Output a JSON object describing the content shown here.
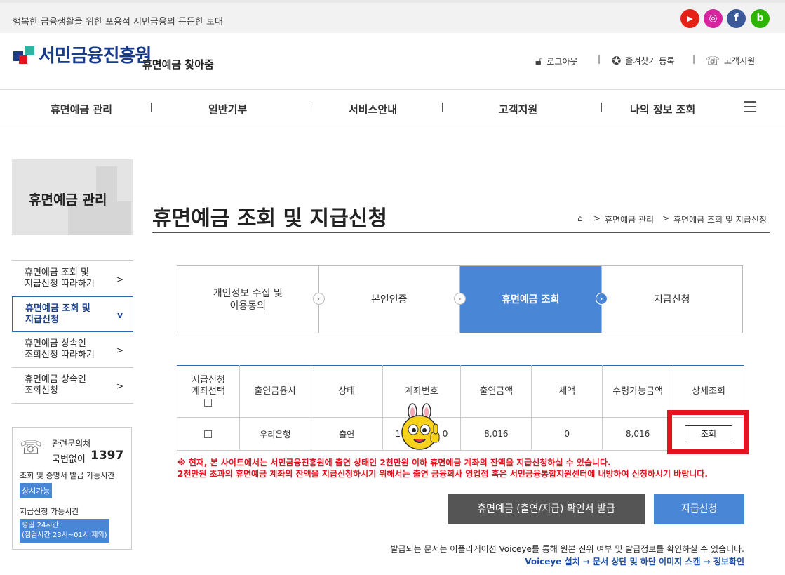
{
  "topbar": {
    "tagline": "행복한 금융생활을 위한 포용적 서민금융의 든든한 토대",
    "social": [
      {
        "name": "youtube-icon",
        "glyph": "▶",
        "color": "#e62117"
      },
      {
        "name": "instagram-icon",
        "glyph": "◎",
        "color": "#d6249f"
      },
      {
        "name": "facebook-icon",
        "glyph": "f",
        "color": "#3b5998"
      },
      {
        "name": "blog-icon",
        "glyph": "b",
        "color": "#2db400"
      }
    ]
  },
  "header": {
    "logo": "서민금융진흥원",
    "subtitle": "휴면예금 찾아줌",
    "logout": "로그아웃",
    "bookmark": "즐겨찾기 등록",
    "support": "고객지원"
  },
  "gnb": [
    "휴면예금 관리",
    "일반기부",
    "서비스안내",
    "고객지원",
    "나의 정보 조회"
  ],
  "sidebar": {
    "title": "휴면예금 관리",
    "items": [
      {
        "label": [
          "휴면예금 조회 및",
          "지급신청 따라하기"
        ],
        "arrow": ">"
      },
      {
        "label": [
          "휴면예금 조회 및",
          "지급신청"
        ],
        "arrow": "v"
      },
      {
        "label": [
          "휴면예금 상속인",
          "조회신청 따라하기"
        ],
        "arrow": ">"
      },
      {
        "label": [
          "휴면예금 상속인",
          "조회신청"
        ],
        "arrow": ">"
      }
    ],
    "cs": {
      "title": "관련문의처",
      "tollfree": "국번없이",
      "phone": "1397",
      "hours_label": "조회 및 증명서 발급 가능시간",
      "hours_value": "상시가능",
      "pay_label": "지급신청 가능시간",
      "pay_value1": "평일 24시간",
      "pay_value2": "(점검시간 23시~01시 제외)"
    }
  },
  "page": {
    "title": "휴면예금 조회 및 지급신청",
    "crumb1": "휴면예금 관리",
    "crumb2": "휴면예금 조회 및 지급신청"
  },
  "steps": [
    {
      "label": [
        "개인정보 수집 및",
        "이용동의"
      ],
      "active": false
    },
    {
      "label": [
        "본인인증"
      ],
      "active": false
    },
    {
      "label": [
        "휴면예금 조회"
      ],
      "active": true
    },
    {
      "label": [
        "지급신청"
      ],
      "active": false
    }
  ],
  "table": {
    "headers": {
      "select1": "지급신청",
      "select2": "계좌선택",
      "bank": "출연금융사",
      "status": "상태",
      "account": "계좌번호",
      "amount": "출연금액",
      "tax": "세액",
      "receivable": "수령가능금액",
      "detail": "상세조회"
    },
    "row": {
      "bank": "우리은행",
      "status": "출연",
      "account_start": "1",
      "account_end": "0",
      "amount": "8,016",
      "tax": "0",
      "receivable": "8,016",
      "detail_btn": "조회"
    }
  },
  "notices": [
    "※ 현재, 본 사이트에서는 서민금융진흥원에 출연 상태인 2천만원 이하 휴면예금 계좌의 잔액을 지급신청하실 수 있습니다.",
    "2천만원 초과의 휴면예금 계좌의 잔액을 지급신청하시기 위해서는 출연 금융회사 영업점 혹은 서민금융통합지원센터에 내방하여 신청하시기 바랍니다."
  ],
  "buttons": {
    "certificate": "휴면예금 (출연/지급) 확인서 발급",
    "apply": "지급신청"
  },
  "footer": {
    "line1": "발급되는 문서는 어플리케이션 Voiceye를 통해 원본 진위 여부 및 발급정보를 확인하실 수 있습니다.",
    "line2": "Voiceye 설치 → 문서 상단 및 하단 이미지 스캔 → 정보확인"
  }
}
